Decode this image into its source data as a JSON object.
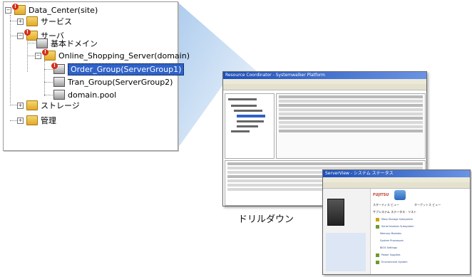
{
  "tree": {
    "root": "Data_Center(site)",
    "service": "サービス",
    "server": "サーバ",
    "basic_domain": "基本ドメイン",
    "domain": "Online_Shopping_Server(domain)",
    "group1": "Order_Group(ServerGroup1)",
    "group2": "Tran_Group(ServerGroup2)",
    "pool": "domain.pool",
    "storage": "ストレージ",
    "admin": "管理"
  },
  "main_window": {
    "title": "Resource Coordinator - Systemwalker Platform"
  },
  "sub_window": {
    "title": "ServerView - システム ステータス",
    "brand": "FUJITSU",
    "nav1": "スターティス ビュー",
    "nav2": "ターゲットス ビュー",
    "heading": "サブシステム ステータス - リスト",
    "items": [
      "Mass Storage Subsystem",
      "Serial Number Subsystem",
      "Memory Modules",
      "System Processors",
      "BIOS Settings",
      "Power Supplies",
      "Environment System"
    ]
  },
  "caption": "ドリルダウン",
  "colors": {
    "wedge": "#cfe1f5",
    "arrow": "#f08a24",
    "selection": "#2f62c9"
  }
}
